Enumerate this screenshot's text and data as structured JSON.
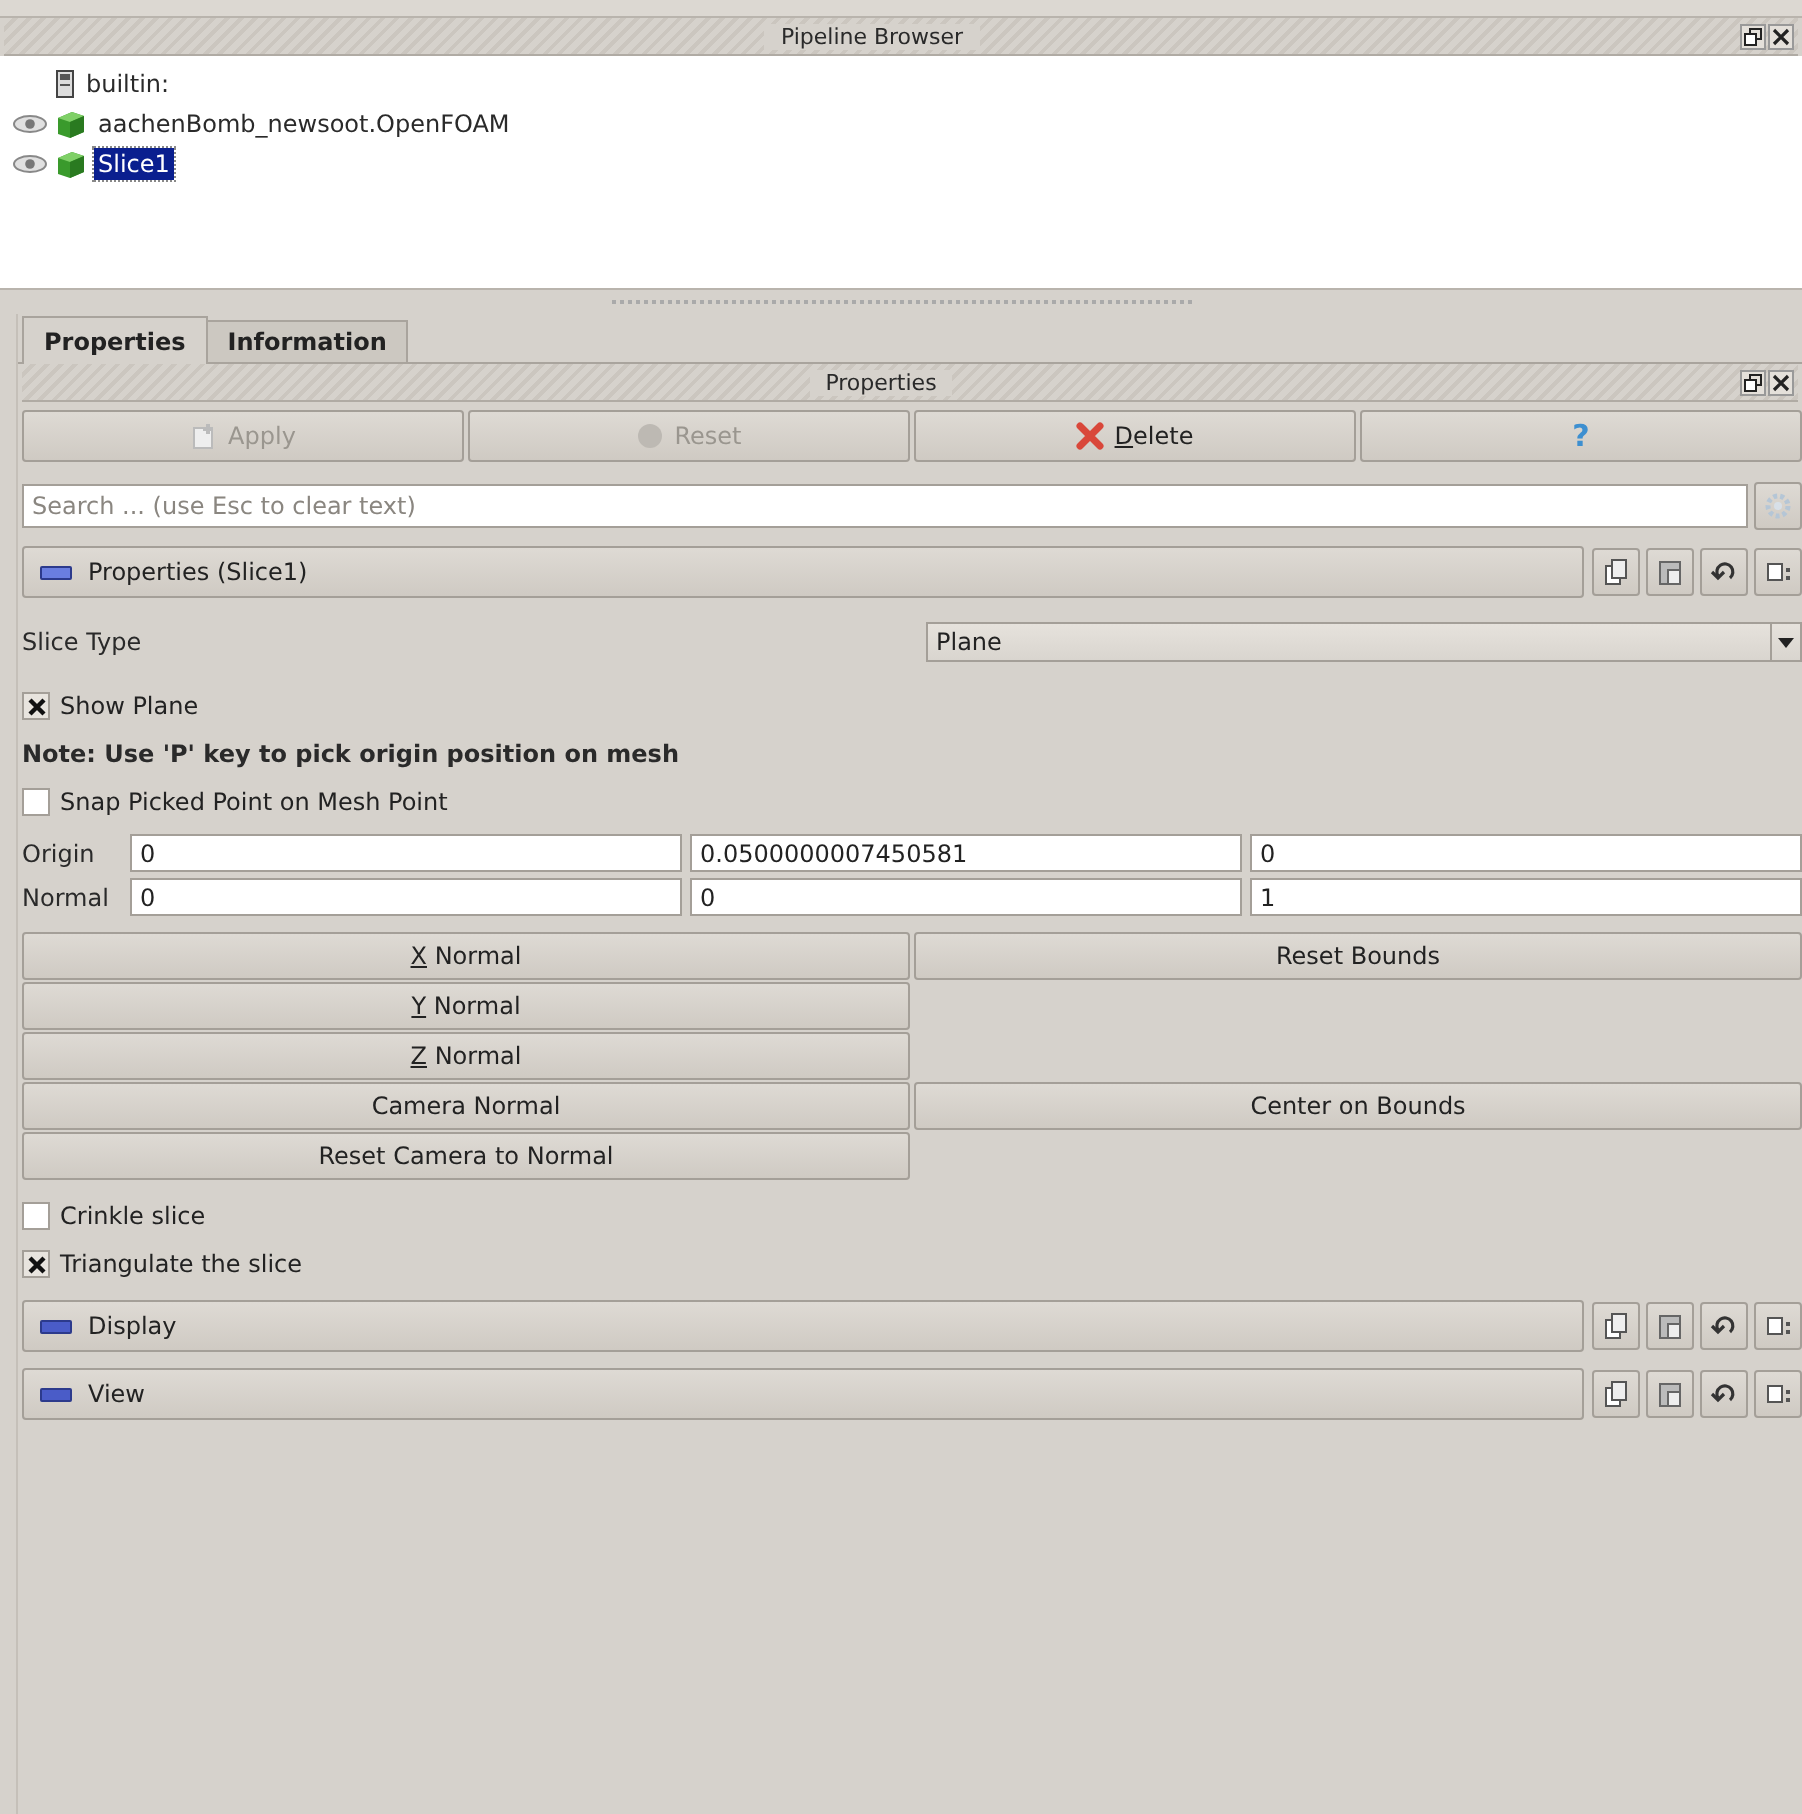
{
  "pipeline_browser": {
    "title": "Pipeline Browser",
    "items": [
      {
        "label": "builtin:",
        "kind": "server",
        "selected": false
      },
      {
        "label": "aachenBomb_newsoot.OpenFOAM",
        "kind": "reader",
        "visible": true,
        "selected": false
      },
      {
        "label": "Slice1",
        "kind": "filter",
        "visible": true,
        "selected": true
      }
    ]
  },
  "tabs": [
    {
      "label": "Properties",
      "selected": true
    },
    {
      "label": "Information",
      "selected": false
    }
  ],
  "properties_panel": {
    "title": "Properties",
    "actions": [
      {
        "label": "Apply",
        "kind": "apply",
        "disabled": true,
        "mnemonic": false
      },
      {
        "label": "Reset",
        "kind": "reset",
        "disabled": true,
        "mnemonic": false
      },
      {
        "label": "Delete",
        "kind": "delete",
        "disabled": false,
        "mnemonic": true
      },
      {
        "label": "?",
        "kind": "help",
        "disabled": false
      }
    ],
    "search": {
      "placeholder": "Search ... (use Esc to clear text)"
    },
    "sections": [
      {
        "title": "Properties (Slice1)",
        "expanded": true
      },
      {
        "title": "Display",
        "expanded": false
      },
      {
        "title": "View",
        "expanded": false
      }
    ],
    "slice_type": {
      "label": "Slice Type",
      "value": "Plane"
    },
    "show_plane": {
      "label": "Show Plane",
      "checked": true
    },
    "note": "Note: Use 'P' key to pick origin position on mesh",
    "snap_picked_point": {
      "label": "Snap Picked Point on Mesh Point",
      "checked": false
    },
    "vectors": [
      {
        "label": "Origin",
        "values": [
          "0",
          "0.0500000007450581",
          "0"
        ]
      },
      {
        "label": "Normal",
        "values": [
          "0",
          "0",
          "1"
        ]
      }
    ],
    "plane_buttons": [
      [
        {
          "label": "X Normal",
          "mnemonic": true
        },
        {
          "label": "Reset Bounds",
          "mnemonic": false
        }
      ],
      [
        {
          "label": "Y Normal",
          "mnemonic": true
        }
      ],
      [
        {
          "label": "Z Normal",
          "mnemonic": true
        }
      ],
      [
        {
          "label": "Camera Normal",
          "mnemonic": false
        },
        {
          "label": "Center on Bounds",
          "mnemonic": false
        }
      ],
      [
        {
          "label": "Reset Camera to Normal",
          "mnemonic": false
        }
      ]
    ],
    "crinkle_slice": {
      "label": "Crinkle slice",
      "checked": false
    },
    "triangulate_slice": {
      "label": "Triangulate the slice",
      "checked": true
    }
  }
}
